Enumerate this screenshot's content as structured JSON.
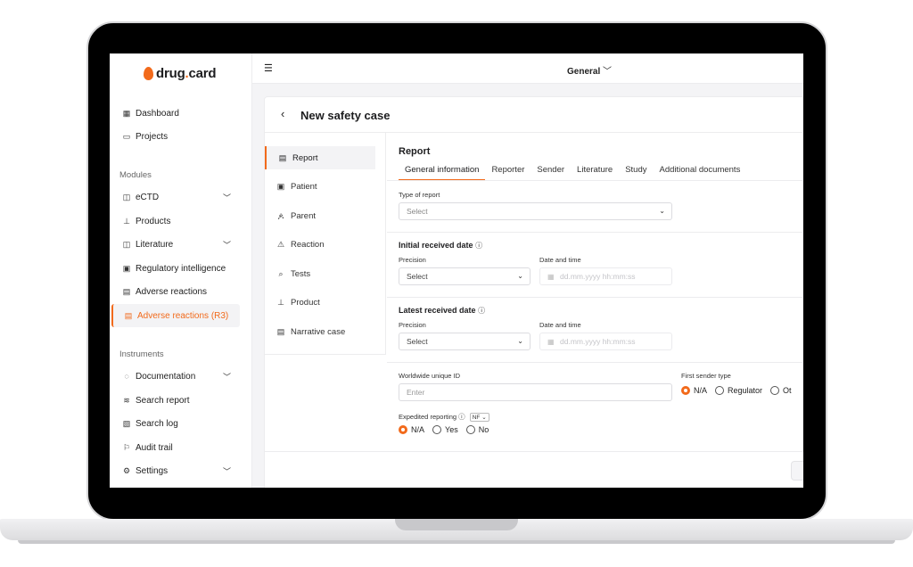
{
  "app": {
    "logo_main": "drug",
    "logo_dot": ".",
    "logo_tail": "card",
    "workspace": "General"
  },
  "sidebar": {
    "items": [
      {
        "label": "Dashboard",
        "icon": "grid-icon"
      },
      {
        "label": "Projects",
        "icon": "folder-icon"
      }
    ],
    "modules_heading": "Modules",
    "modules": [
      {
        "label": "eCTD",
        "icon": "book-icon",
        "expandable": true
      },
      {
        "label": "Products",
        "icon": "flask-icon"
      },
      {
        "label": "Literature",
        "icon": "book-icon",
        "expandable": true
      },
      {
        "label": "Regulatory intelligence",
        "icon": "clipboard-icon"
      },
      {
        "label": "Adverse reactions",
        "icon": "document-icon"
      },
      {
        "label": "Adverse reactions (R3)",
        "icon": "document-icon",
        "active": true
      }
    ],
    "instruments_heading": "Instruments",
    "instruments": [
      {
        "label": "Documentation",
        "icon": "chat-icon",
        "expandable": true
      },
      {
        "label": "Search report",
        "icon": "layers-icon"
      },
      {
        "label": "Search log",
        "icon": "log-icon"
      },
      {
        "label": "Audit trail",
        "icon": "flag-icon"
      },
      {
        "label": "Settings",
        "icon": "gear-icon",
        "expandable": true
      }
    ]
  },
  "page": {
    "back": "‹",
    "title": "New safety case"
  },
  "case_nav": [
    {
      "label": "Report",
      "icon": "report-icon",
      "active": true
    },
    {
      "label": "Patient",
      "icon": "patient-icon"
    },
    {
      "label": "Parent",
      "icon": "parent-icon"
    },
    {
      "label": "Reaction",
      "icon": "warning-icon"
    },
    {
      "label": "Tests",
      "icon": "search-icon"
    },
    {
      "label": "Product",
      "icon": "flask-icon"
    },
    {
      "label": "Narrative case",
      "icon": "document-icon"
    }
  ],
  "report": {
    "title": "Report",
    "tabs": [
      "General information",
      "Reporter",
      "Sender",
      "Literature",
      "Study",
      "Additional documents"
    ],
    "active_tab": 0,
    "type_of_report": {
      "label": "Type of report",
      "placeholder": "Select"
    },
    "initial_received": {
      "title": "Initial received date",
      "precision_label": "Precision",
      "precision_value": "Select",
      "datetime_label": "Date and time",
      "datetime_placeholder": "dd.mm.yyyy hh:mm:ss"
    },
    "latest_received": {
      "title": "Latest received date",
      "precision_label": "Precision",
      "precision_value": "Select",
      "datetime_label": "Date and time",
      "datetime_placeholder": "dd.mm.yyyy hh:mm:ss"
    },
    "worldwide_id": {
      "label": "Worldwide unique ID",
      "placeholder": "Enter"
    },
    "first_sender": {
      "label": "First sender type",
      "options": [
        "N/A",
        "Regulator",
        "Ot"
      ],
      "selected": 0
    },
    "expedited": {
      "label": "Expedited reporting",
      "nf": "NF",
      "options": [
        "N/A",
        "Yes",
        "No"
      ],
      "selected": 0
    }
  },
  "colors": {
    "accent": "#f26a1b",
    "background": "#f4f4f6"
  }
}
